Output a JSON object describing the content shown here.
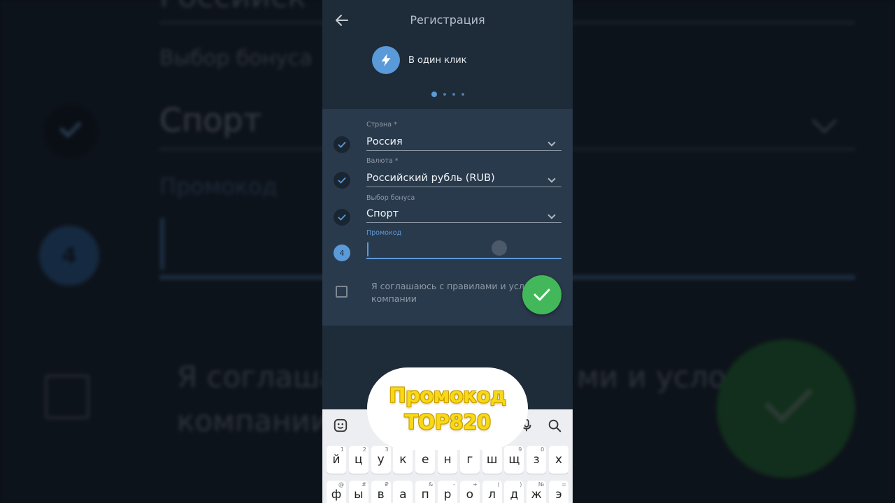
{
  "background": {
    "top_text": "Российск",
    "bonus_label": "Выбор бонуса",
    "bonus_value": "Спорт",
    "promo_label": "Промокод",
    "step_number": "4",
    "agree_line1": "Я соглаша",
    "agree_line1_right": "ми и услов",
    "agree_line2": "компании"
  },
  "header": {
    "title": "Регистрация"
  },
  "method": {
    "label": "В один клик"
  },
  "form": {
    "fields": [
      {
        "label": "Страна *",
        "value": "Россия"
      },
      {
        "label": "Валюта *",
        "value": "Российский рубль (RUB)"
      },
      {
        "label": "Выбор бонуса",
        "value": "Спорт"
      },
      {
        "label": "Промокод",
        "value": "",
        "step": "4"
      }
    ],
    "agree_line1": "Я соглашаюсь с правилами и условиями",
    "agree_line2": "компании"
  },
  "keyboard": {
    "row1": [
      {
        "k": "й",
        "h": "1"
      },
      {
        "k": "ц",
        "h": "2"
      },
      {
        "k": "у",
        "h": "3"
      },
      {
        "k": "к",
        "h": ""
      },
      {
        "k": "е",
        "h": ""
      },
      {
        "k": "н",
        "h": ""
      },
      {
        "k": "г",
        "h": ""
      },
      {
        "k": "ш",
        "h": ""
      },
      {
        "k": "щ",
        "h": "9"
      },
      {
        "k": "з",
        "h": "0"
      },
      {
        "k": "х",
        "h": ""
      }
    ],
    "row2": [
      {
        "k": "ф",
        "h": "@"
      },
      {
        "k": "ы",
        "h": "#"
      },
      {
        "k": "в",
        "h": "₽"
      },
      {
        "k": "а",
        "h": ""
      },
      {
        "k": "п",
        "h": "&"
      },
      {
        "k": "р",
        "h": "-"
      },
      {
        "k": "о",
        "h": "+"
      },
      {
        "k": "л",
        "h": "("
      },
      {
        "k": "д",
        "h": ")"
      },
      {
        "k": "ж",
        "h": "№"
      },
      {
        "k": "э",
        "h": "="
      }
    ]
  },
  "promo": {
    "line1": "Промокод",
    "line2": "TOP820"
  },
  "colors": {
    "accent": "#5a9ad8",
    "confirm": "#43b85a",
    "promo_text": "#f7d916"
  }
}
